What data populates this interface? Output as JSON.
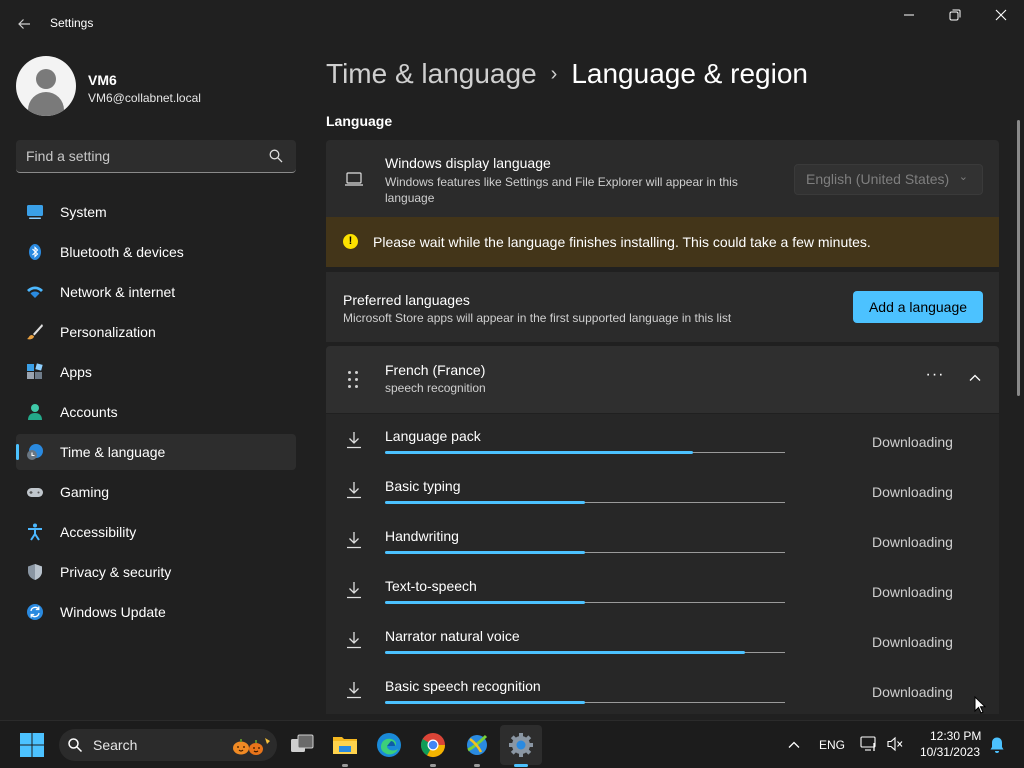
{
  "window": {
    "title": "Settings"
  },
  "profile": {
    "name": "VM6",
    "email": "VM6@collabnet.local"
  },
  "search": {
    "placeholder": "Find a setting"
  },
  "sidebar": {
    "items": [
      {
        "label": "System",
        "icon": "system-icon"
      },
      {
        "label": "Bluetooth & devices",
        "icon": "bluetooth-icon"
      },
      {
        "label": "Network & internet",
        "icon": "network-icon"
      },
      {
        "label": "Personalization",
        "icon": "brush-icon"
      },
      {
        "label": "Apps",
        "icon": "apps-icon"
      },
      {
        "label": "Accounts",
        "icon": "accounts-icon"
      },
      {
        "label": "Time & language",
        "icon": "time-language-icon",
        "active": true
      },
      {
        "label": "Gaming",
        "icon": "gaming-icon"
      },
      {
        "label": "Accessibility",
        "icon": "accessibility-icon"
      },
      {
        "label": "Privacy & security",
        "icon": "shield-icon"
      },
      {
        "label": "Windows Update",
        "icon": "update-icon"
      }
    ]
  },
  "breadcrumb": {
    "parent": "Time & language",
    "separator": "›",
    "current": "Language & region"
  },
  "language_section": {
    "title": "Language",
    "display_language": {
      "title": "Windows display language",
      "description": "Windows features like Settings and File Explorer will appear in this language",
      "selected": "English (United States)"
    },
    "warning": "Please wait while the language finishes installing. This could take a few minutes.",
    "preferred": {
      "title": "Preferred languages",
      "description": "Microsoft Store apps will appear in the first supported language in this list",
      "add_button": "Add a language"
    },
    "language_item": {
      "name": "French (France)",
      "subtitle": "speech recognition",
      "more_label": "···"
    },
    "downloads": [
      {
        "name": "Language pack",
        "status": "Downloading",
        "progress": 0.77
      },
      {
        "name": "Basic typing",
        "status": "Downloading",
        "progress": 0.5
      },
      {
        "name": "Handwriting",
        "status": "Downloading",
        "progress": 0.5
      },
      {
        "name": "Text-to-speech",
        "status": "Downloading",
        "progress": 0.5
      },
      {
        "name": "Narrator natural voice",
        "status": "Downloading",
        "progress": 0.9
      },
      {
        "name": "Basic speech recognition",
        "status": "Downloading",
        "progress": 0.5
      }
    ]
  },
  "taskbar": {
    "search_label": "Search",
    "apps": [
      "start-icon",
      "task-view-icon",
      "file-explorer-icon",
      "edge-icon",
      "chrome-icon",
      "network-app-icon",
      "settings-app-icon"
    ],
    "tray": {
      "language": "ENG",
      "time": "12:30 PM",
      "date": "10/31/2023"
    }
  },
  "colors": {
    "accent": "#4cc2ff",
    "warning_bg": "#433519",
    "warning_icon": "#fce100",
    "card": "#2b2b2b",
    "background": "#202020"
  }
}
